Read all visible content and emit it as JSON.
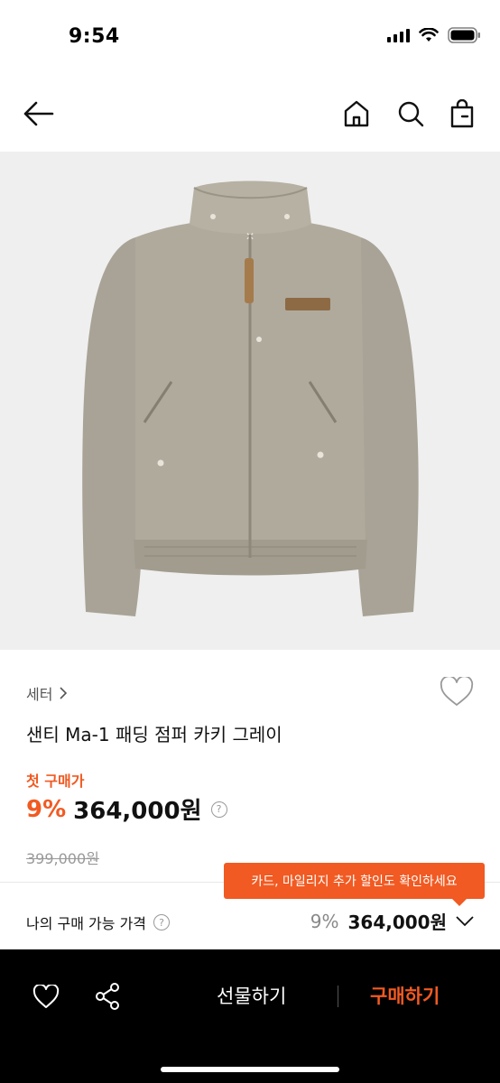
{
  "status_bar": {
    "time": "9:54",
    "icons": [
      "signal-icon",
      "wifi-icon",
      "battery-icon"
    ]
  },
  "nav": {
    "back_icon": "arrow-left-icon",
    "home_icon": "home-icon",
    "search_icon": "search-icon",
    "bag_icon": "shopping-bag-icon"
  },
  "product": {
    "image_alt": "khaki gray padded jacket",
    "category": "세터",
    "name": "샌티 Ma-1 패딩 점퍼 카키 그레이",
    "price_label": "첫 구매가",
    "discount": "9%",
    "price": "364,000원",
    "original_price": "399,000원"
  },
  "tooltip": {
    "text": "카드, 마일리지 추가 할인도 확인하세요"
  },
  "my_price": {
    "label": "나의 구매 가능 가격",
    "discount": "9%",
    "price": "364,000원"
  },
  "bottom_bar": {
    "gift_label": "선물하기",
    "buy_label": "구매하기"
  },
  "colors": {
    "accent": "#f15a22",
    "bottom_bar_bg": "#000000",
    "image_bg": "#efefef"
  }
}
